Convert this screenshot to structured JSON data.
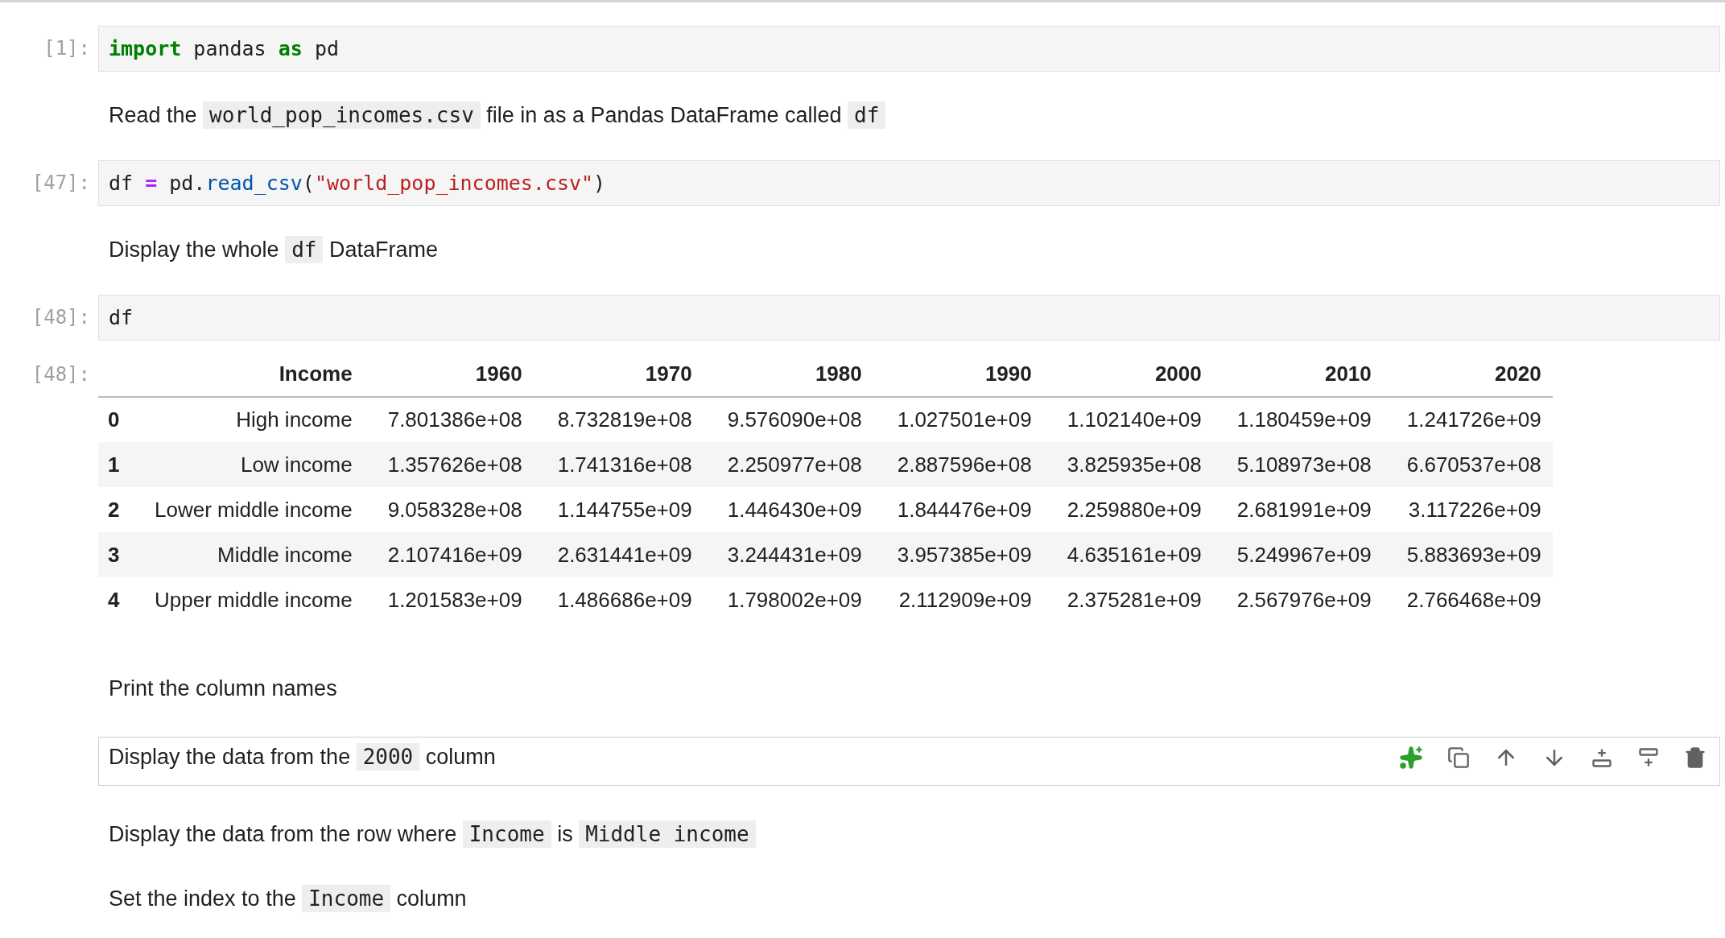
{
  "cells": [
    {
      "kind": "code",
      "prompt": "[1]:",
      "tokens": [
        {
          "kind": "keyword",
          "text": "import"
        },
        {
          "kind": "plain",
          "text": " pandas "
        },
        {
          "kind": "keyword",
          "text": "as"
        },
        {
          "kind": "plain",
          "text": " pd"
        }
      ]
    },
    {
      "kind": "markdown",
      "selected": false,
      "parts": [
        {
          "kind": "text",
          "text": "Read the "
        },
        {
          "kind": "code",
          "text": "world_pop_incomes.csv"
        },
        {
          "kind": "text",
          "text": " file in as a Pandas DataFrame called "
        },
        {
          "kind": "code",
          "text": "df"
        }
      ]
    },
    {
      "kind": "code",
      "prompt": "[47]:",
      "tokens": [
        {
          "kind": "plain",
          "text": "df "
        },
        {
          "kind": "operator",
          "text": "="
        },
        {
          "kind": "plain",
          "text": " pd."
        },
        {
          "kind": "function",
          "text": "read_csv"
        },
        {
          "kind": "plain",
          "text": "("
        },
        {
          "kind": "string",
          "text": "\"world_pop_incomes.csv\""
        },
        {
          "kind": "plain",
          "text": ")"
        }
      ]
    },
    {
      "kind": "markdown",
      "selected": false,
      "parts": [
        {
          "kind": "text",
          "text": "Display the whole "
        },
        {
          "kind": "code",
          "text": "df"
        },
        {
          "kind": "text",
          "text": " DataFrame"
        }
      ]
    },
    {
      "kind": "code",
      "prompt": "[48]:",
      "tokens": [
        {
          "kind": "plain",
          "text": "df"
        }
      ]
    },
    {
      "kind": "output",
      "prompt": "[48]:",
      "table": {
        "columns": [
          "Income",
          "1960",
          "1970",
          "1980",
          "1990",
          "2000",
          "2010",
          "2020"
        ],
        "rows": [
          {
            "index": "0",
            "cells": [
              "High income",
              "7.801386e+08",
              "8.732819e+08",
              "9.576090e+08",
              "1.027501e+09",
              "1.102140e+09",
              "1.180459e+09",
              "1.241726e+09"
            ]
          },
          {
            "index": "1",
            "cells": [
              "Low income",
              "1.357626e+08",
              "1.741316e+08",
              "2.250977e+08",
              "2.887596e+08",
              "3.825935e+08",
              "5.108973e+08",
              "6.670537e+08"
            ]
          },
          {
            "index": "2",
            "cells": [
              "Lower middle income",
              "9.058328e+08",
              "1.144755e+09",
              "1.446430e+09",
              "1.844476e+09",
              "2.259880e+09",
              "2.681991e+09",
              "3.117226e+09"
            ]
          },
          {
            "index": "3",
            "cells": [
              "Middle income",
              "2.107416e+09",
              "2.631441e+09",
              "3.244431e+09",
              "3.957385e+09",
              "4.635161e+09",
              "5.249967e+09",
              "5.883693e+09"
            ]
          },
          {
            "index": "4",
            "cells": [
              "Upper middle income",
              "1.201583e+09",
              "1.486686e+09",
              "1.798002e+09",
              "2.112909e+09",
              "2.375281e+09",
              "2.567976e+09",
              "2.766468e+09"
            ]
          }
        ]
      }
    },
    {
      "kind": "markdown",
      "selected": false,
      "parts": [
        {
          "kind": "text",
          "text": "Print the column names"
        }
      ]
    },
    {
      "kind": "markdown",
      "selected": true,
      "parts": [
        {
          "kind": "text",
          "text": "Display the data from the "
        },
        {
          "kind": "code",
          "text": "2000"
        },
        {
          "kind": "text",
          "text": " column"
        }
      ]
    },
    {
      "kind": "markdown",
      "selected": false,
      "parts": [
        {
          "kind": "text",
          "text": "Display the data from the row where "
        },
        {
          "kind": "code",
          "text": "Income"
        },
        {
          "kind": "text",
          "text": " is "
        },
        {
          "kind": "code",
          "text": "Middle income"
        }
      ]
    },
    {
      "kind": "markdown",
      "selected": false,
      "parts": [
        {
          "kind": "text",
          "text": "Set the index to the "
        },
        {
          "kind": "code",
          "text": "Income"
        },
        {
          "kind": "text",
          "text": " column"
        }
      ]
    }
  ]
}
